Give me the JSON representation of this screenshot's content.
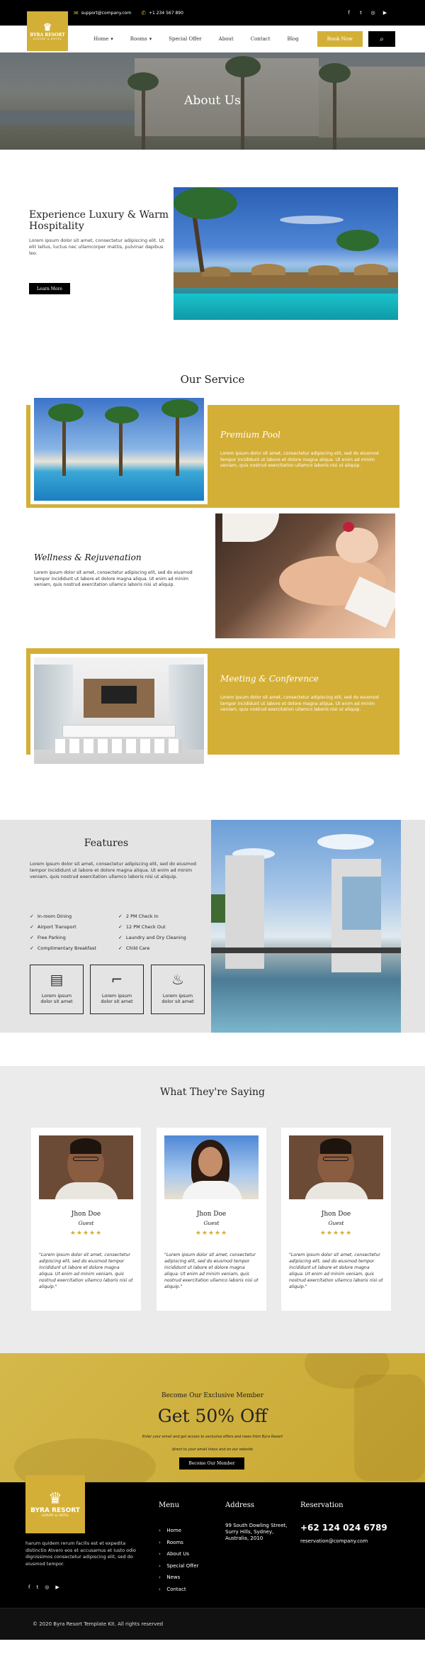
{
  "topbar": {
    "email": "support@company.com",
    "phone": "+1 234 567 890",
    "social_icons": [
      "facebook-icon",
      "twitter-icon",
      "instagram-icon",
      "youtube-icon"
    ]
  },
  "brand": {
    "name": "BYRA RESORT",
    "tagline": "LUXURY & HOTEL"
  },
  "nav": {
    "items": [
      "Home",
      "Rooms",
      "Special Offer",
      "About",
      "Contact",
      "Blog"
    ],
    "book_label": "Book Now"
  },
  "hero": {
    "title": "About Us"
  },
  "experience": {
    "title": "Experience Luxury & Warm Hospitality",
    "text": "Lorem ipsum dolor sit amet, consectetur adipiscing elit. Ut elit tellus, luctus nec ullamcorper mattis, pulvinar dapibus leo.",
    "button": "Learn More"
  },
  "services": {
    "title": "Our Service",
    "items": [
      {
        "title": "Premium Pool",
        "text": "Lorem ipsum dolor sit amet, consectetur adipiscing elit, sed do eiusmod tempor incididunt ut labore et dolore magna aliqua. Ut enim ad minim veniam, quis nostrud exercitation ullamco laboris nisi ut aliquip."
      },
      {
        "title": "Wellness & Rejuvenation",
        "text": "Lorem ipsum dolor sit amet, consectetur adipiscing elit, sed do eiusmod tempor incididunt ut labore et dolore magna aliqua. Ut enim ad minim veniam, quis nostrud exercitation ullamco laboris nisi ut aliquip."
      },
      {
        "title": "Meeting & Conference",
        "text": "Lorem ipsum dolor sit amet, consectetur adipiscing elit, sed do eiusmod tempor incididunt ut labore et dolore magna aliqua. Ut enim ad minim veniam, quis nostrud exercitation ullamco laboris nisi ut aliquip."
      }
    ]
  },
  "features": {
    "title": "Features",
    "text": "Lorem ipsum dolor sit amet, consectetur adipiscing elit, sed do eiusmod tempor incididunt ut labore et dolore magna aliqua. Ut enim ad minim veniam, quis nostrud exercitation ullamco laboris nisi ut aliquip.",
    "list": [
      "In-room Dining",
      "2 PM Check In",
      "Airport Transport",
      "12 PM Check Out",
      "Free Parking",
      "Laundry and Dry Cleaning",
      "Complimentary Breakfast",
      "Child Care"
    ],
    "boxes": [
      "Lorem ipsum dolor sit amet",
      "Lorem ipsum dolor sit amet",
      "Lorem ipsum dolor sit amet"
    ]
  },
  "testimonials": {
    "title": "What They're Saying",
    "items": [
      {
        "name": "Jhon Doe",
        "role": "Guest",
        "stars": "★★★★★",
        "quote": "\"Lorem ipsum dolor sit amet, consectetur adipiscing elit, sed do eiusmod tempor incididunt ut labore et dolore magna aliqua. Ut enim ad minim veniam, quis nostrud exercitation ullamco laboris nisi ut aliquip.\""
      },
      {
        "name": "Jhon Doe",
        "role": "Guest",
        "stars": "★★★★★",
        "quote": "\"Lorem ipsum dolor sit amet, consectetur adipiscing elit, sed do eiusmod tempor incididunt ut labore et dolore magna aliqua. Ut enim ad minim veniam, quis nostrud exercitation ullamco laboris nisi ut aliquip.\""
      },
      {
        "name": "Jhon Doe",
        "role": "Guest",
        "stars": "★★★★★",
        "quote": "\"Lorem ipsum dolor sit amet, consectetur adipiscing elit, sed do eiusmod tempor incididunt ut labore et dolore magna aliqua. Ut enim ad minim veniam, quis nostrud exercitation ullamco laboris nisi ut aliquip.\""
      }
    ]
  },
  "member": {
    "kicker": "Become Our Exclusive Member",
    "headline": "Get 50% Off",
    "line1": "Enter your email and get access to exclusive offers and news from Byra Resort",
    "line2": "direct to your email inbox and on our website",
    "button": "Become Our Member"
  },
  "footer": {
    "about": "harum quidem rerum facilis est et expedita distinctio Atvero eos et accusamus et iusto odio dignissimos consectetur adipiscing elit, sed do eiusmod tempor.",
    "menu_title": "Menu",
    "menu": [
      "Home",
      "Rooms",
      "About Us",
      "Special Offer",
      "News",
      "Contact"
    ],
    "address_title": "Address",
    "address": "99 South Dowling Street, Surry Hills, Sydney, Australia, 2010",
    "reservation_title": "Reservation",
    "phone": "+62 124 024 6789",
    "email": "reservation@company.com",
    "copyright": "© 2020 Byra Resort Template Kit. All rights reserved"
  },
  "colors": {
    "accent": "#d4af37",
    "dark": "#000000",
    "light": "#e4e4e4"
  }
}
